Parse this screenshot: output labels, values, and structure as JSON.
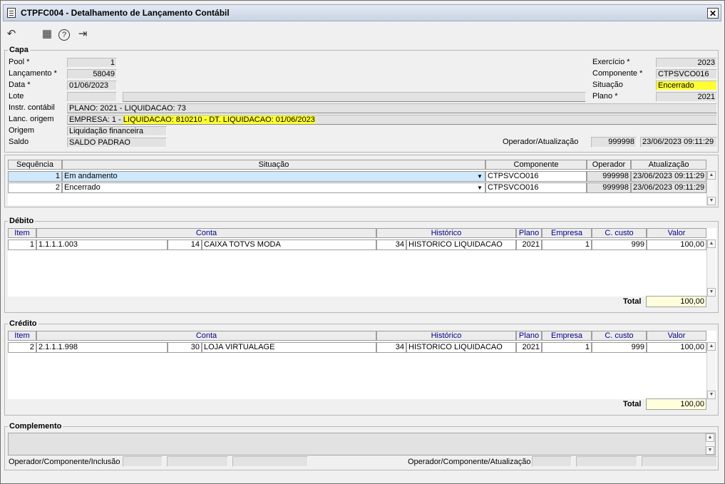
{
  "window": {
    "title": "CTPFC004 - Detalhamento de Lançamento Contábil",
    "close": "✕"
  },
  "toolbar": {
    "undo_icon": "↶",
    "calendar_icon": "▦",
    "help_icon": "?",
    "exit_icon": "⇥"
  },
  "capa": {
    "legend": "Capa",
    "labels": {
      "pool": "Pool *",
      "lancamento": "Lançamento *",
      "data": "Data *",
      "lote": "Lote",
      "instr": "Instr. contábil",
      "lanc_origem": "Lanc. origem",
      "origem": "Origem",
      "saldo": "Saldo",
      "exercicio": "Exercício *",
      "componente": "Componente *",
      "situacao": "Situação",
      "plano": "Plano *",
      "operador_atualizacao": "Operador/Atualização"
    },
    "values": {
      "pool": "1",
      "lancamento": "58049",
      "data": "01/06/2023",
      "lote": "",
      "lote_desc": "",
      "instr": "PLANO: 2021 - LIQUIDACAO: 73",
      "lanc_origem_prefix": "EMPRESA: 1 - ",
      "lanc_origem_highlight": "LIQUIDACAO: 810210 - DT. LIQUIDACAO: 01/06/2023",
      "origem": "Liquidação financeira",
      "saldo": "SALDO PADRAO",
      "exercicio": "2023",
      "componente": "CTPSVCO016",
      "situacao": "Encerrado",
      "plano": "2021",
      "operador": "999998",
      "atualizacao": "23/06/2023 09:11:29"
    }
  },
  "situacoes": {
    "headers": {
      "sequencia": "Sequência",
      "situacao": "Situação",
      "componente": "Componente",
      "operador": "Operador",
      "atualizacao": "Atualização"
    },
    "rows": [
      {
        "seq": "1",
        "situacao": "Em andamento",
        "componente": "CTPSVCO016",
        "operador": "999998",
        "atualizacao": "23/06/2023 09:11:29"
      },
      {
        "seq": "2",
        "situacao": "Encerrado",
        "componente": "CTPSVCO016",
        "operador": "999998",
        "atualizacao": "23/06/2023 09:11:29"
      }
    ]
  },
  "debito": {
    "legend": "Débito",
    "headers": {
      "item": "Item",
      "conta": "Conta",
      "historico": "Histórico",
      "plano": "Plano",
      "empresa": "Empresa",
      "ccusto": "C. custo",
      "valor": "Valor"
    },
    "rows": [
      {
        "item": "1",
        "conta": "1.1.1.1.003",
        "conta_num": "14",
        "conta_desc": "CAIXA TOTVS MODA",
        "hist_num": "34",
        "hist_desc": "HISTORICO LIQUIDACAO",
        "plano": "2021",
        "empresa": "1",
        "ccusto": "999",
        "valor": "100,00"
      }
    ],
    "total_label": "Total",
    "total": "100,00"
  },
  "credito": {
    "legend": "Crédito",
    "headers": {
      "item": "Item",
      "conta": "Conta",
      "historico": "Histórico",
      "plano": "Plano",
      "empresa": "Empresa",
      "ccusto": "C. custo",
      "valor": "Valor"
    },
    "rows": [
      {
        "item": "2",
        "conta": "2.1.1.1.998",
        "conta_num": "30",
        "conta_desc": "LOJA VIRTUALAGE",
        "hist_num": "34",
        "hist_desc": "HISTORICO LIQUIDACAO",
        "plano": "2021",
        "empresa": "1",
        "ccusto": "999",
        "valor": "100,00"
      }
    ],
    "total_label": "Total",
    "total": "100,00"
  },
  "complemento": {
    "legend": "Complemento",
    "op_comp_inclusao": "Operador/Componente/Inclusão",
    "op_comp_atualizacao": "Operador/Componente/Atualização"
  },
  "icons": {
    "dropdown": "▼",
    "scroll_up": "▲",
    "scroll_down": "▼"
  }
}
